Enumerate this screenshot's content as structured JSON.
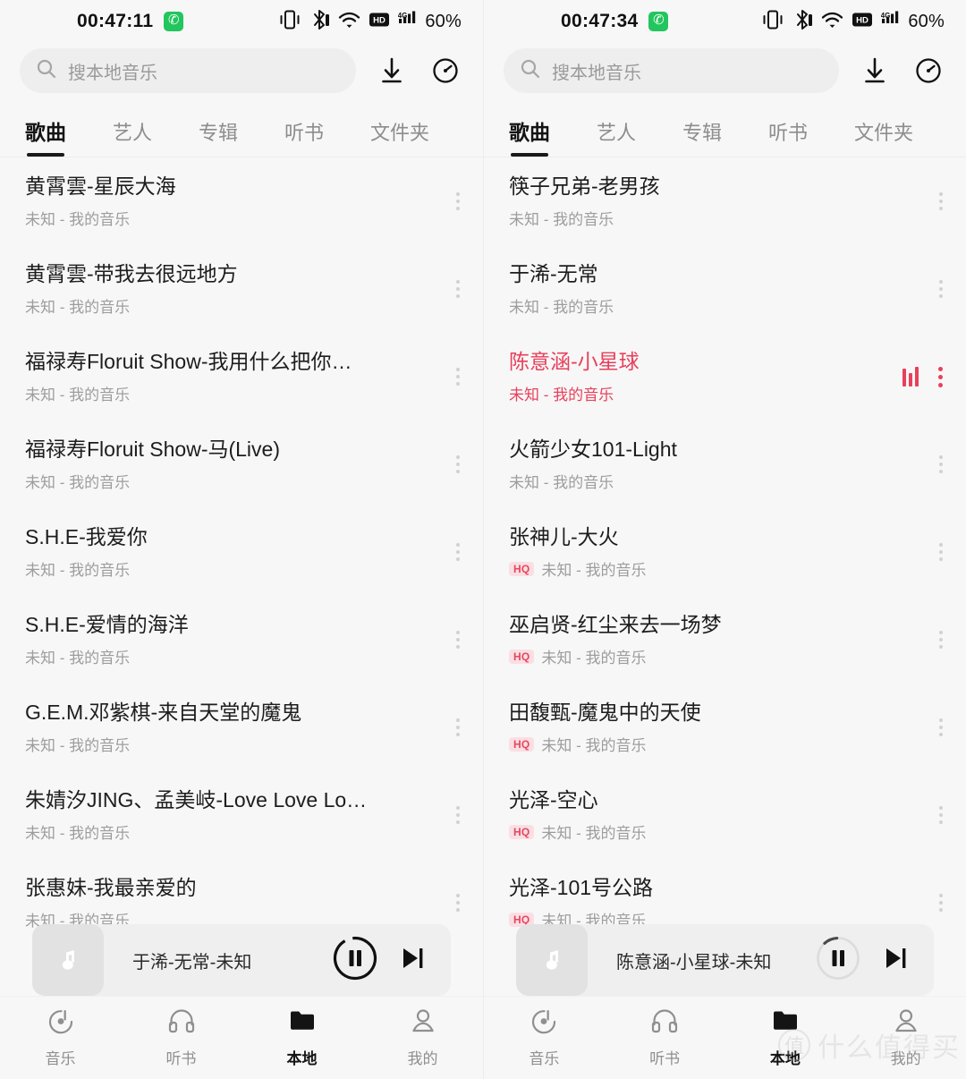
{
  "panels": [
    {
      "id": "left",
      "status": {
        "time": "00:47:11",
        "call_icon": "phone-icon",
        "icons": [
          "vibrate-icon",
          "bluetooth-icon",
          "wifi-icon",
          "hd-icon",
          "signal-4g-icon"
        ],
        "battery": "60%"
      },
      "search": {
        "placeholder": "搜本地音乐",
        "icon": "search-icon"
      },
      "actions": {
        "download": "download-icon",
        "timer": "sleep-timer-icon"
      },
      "tabs": [
        {
          "label": "歌曲",
          "active": true
        },
        {
          "label": "艺人",
          "active": false
        },
        {
          "label": "专辑",
          "active": false
        },
        {
          "label": "听书",
          "active": false
        },
        {
          "label": "文件夹",
          "active": false
        }
      ],
      "songs": [
        {
          "title": "黄霄雲-星辰大海",
          "sub": "未知 - 我的音乐",
          "hq": false,
          "playing": false
        },
        {
          "title": "黄霄雲-带我去很远地方",
          "sub": "未知 - 我的音乐",
          "hq": false,
          "playing": false
        },
        {
          "title": "福禄寿Floruit Show-我用什么把你…",
          "sub": "未知 - 我的音乐",
          "hq": false,
          "playing": false
        },
        {
          "title": "福禄寿Floruit Show-马(Live)",
          "sub": "未知 - 我的音乐",
          "hq": false,
          "playing": false
        },
        {
          "title": "S.H.E-我爱你",
          "sub": "未知 - 我的音乐",
          "hq": false,
          "playing": false
        },
        {
          "title": "S.H.E-爱情的海洋",
          "sub": "未知 - 我的音乐",
          "hq": false,
          "playing": false
        },
        {
          "title": "G.E.M.邓紫棋-来自天堂的魔鬼",
          "sub": "未知 - 我的音乐",
          "hq": false,
          "playing": false
        },
        {
          "title": "朱婧汐JING、孟美岐-Love Love Lo…",
          "sub": "未知 - 我的音乐",
          "hq": false,
          "playing": false
        },
        {
          "title": "张惠妹-我最亲爱的",
          "sub": "未知 - 我的音乐",
          "hq": false,
          "playing": false
        }
      ],
      "player": {
        "now_playing": "于浠-无常-未知",
        "state": "paused",
        "loading": false,
        "art_icon": "music-note-icon"
      },
      "nav": [
        {
          "label": "音乐",
          "icon": "music-disc-icon",
          "active": false
        },
        {
          "label": "听书",
          "icon": "headphones-icon",
          "active": false
        },
        {
          "label": "本地",
          "icon": "folder-icon",
          "active": true
        },
        {
          "label": "我的",
          "icon": "person-icon",
          "active": false
        }
      ],
      "watermark": null
    },
    {
      "id": "right",
      "status": {
        "time": "00:47:34",
        "call_icon": "phone-icon",
        "icons": [
          "vibrate-icon",
          "bluetooth-icon",
          "wifi-icon",
          "hd-icon",
          "signal-4g-icon"
        ],
        "battery": "60%"
      },
      "search": {
        "placeholder": "搜本地音乐",
        "icon": "search-icon"
      },
      "actions": {
        "download": "download-icon",
        "timer": "sleep-timer-icon"
      },
      "tabs": [
        {
          "label": "歌曲",
          "active": true
        },
        {
          "label": "艺人",
          "active": false
        },
        {
          "label": "专辑",
          "active": false
        },
        {
          "label": "听书",
          "active": false
        },
        {
          "label": "文件夹",
          "active": false
        }
      ],
      "songs": [
        {
          "title": "筷子兄弟-老男孩",
          "sub": "未知 - 我的音乐",
          "hq": false,
          "playing": false
        },
        {
          "title": "于浠-无常",
          "sub": "未知 - 我的音乐",
          "hq": false,
          "playing": false
        },
        {
          "title": "陈意涵-小星球",
          "sub": "未知 - 我的音乐",
          "hq": false,
          "playing": true
        },
        {
          "title": "火箭少女101-Light",
          "sub": "未知 - 我的音乐",
          "hq": false,
          "playing": false
        },
        {
          "title": "张神儿-大火",
          "sub": "未知 - 我的音乐",
          "hq": true,
          "playing": false
        },
        {
          "title": "巫启贤-红尘来去一场梦",
          "sub": "未知 - 我的音乐",
          "hq": true,
          "playing": false
        },
        {
          "title": "田馥甄-魔鬼中的天使",
          "sub": "未知 - 我的音乐",
          "hq": true,
          "playing": false
        },
        {
          "title": "光泽-空心",
          "sub": "未知 - 我的音乐",
          "hq": true,
          "playing": false
        },
        {
          "title": "光泽-101号公路",
          "sub": "未知 - 我的音乐",
          "hq": true,
          "playing": false
        }
      ],
      "player": {
        "now_playing": "陈意涵-小星球-未知",
        "state": "paused",
        "loading": true,
        "art_icon": "music-note-icon"
      },
      "nav": [
        {
          "label": "音乐",
          "icon": "music-disc-icon",
          "active": false
        },
        {
          "label": "听书",
          "icon": "headphones-icon",
          "active": false
        },
        {
          "label": "本地",
          "icon": "folder-icon",
          "active": true
        },
        {
          "label": "我的",
          "icon": "person-icon",
          "active": false
        }
      ],
      "watermark": {
        "badge": "值",
        "text": "什么值得买"
      }
    }
  ],
  "colors": {
    "accent_red": "#e8405c",
    "hq_bg": "#fbdee3",
    "hq_fg": "#e4485f",
    "active_dark": "#141414",
    "muted": "#9d9d9d",
    "page_bg": "#f7f7f7"
  }
}
